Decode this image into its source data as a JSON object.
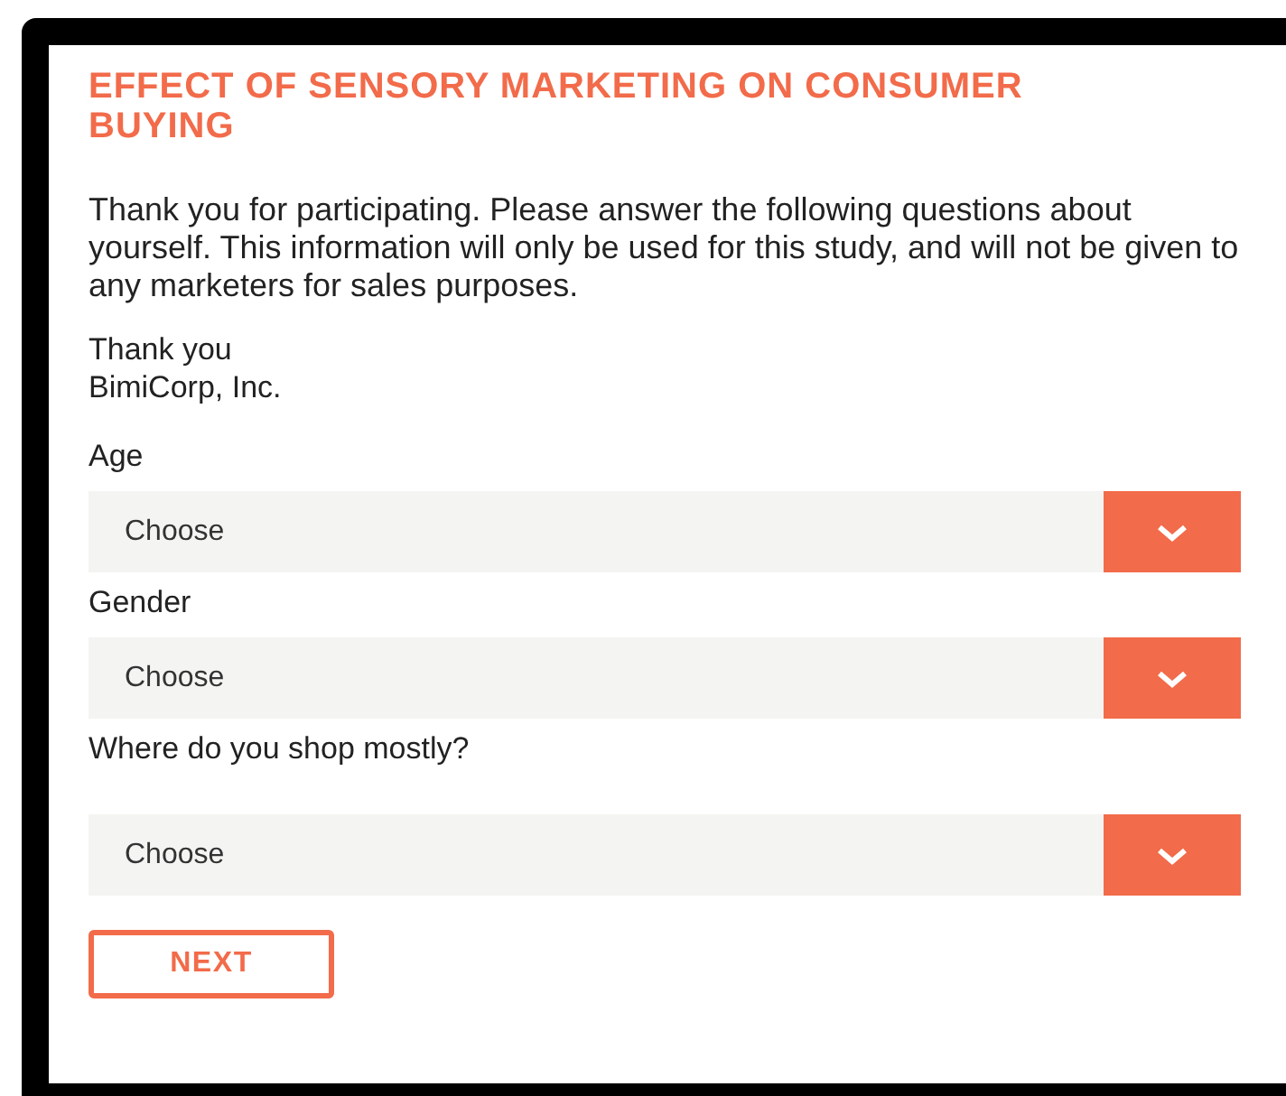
{
  "title": "EFFECT OF SENSORY MARKETING ON CONSUMER BUYING",
  "intro": "Thank you for participating. Please answer the following questions about yourself. This information will only be used for this study, and will not be given to any marketers for sales purposes.",
  "signoff": [
    "Thank you",
    "BimiCorp, Inc."
  ],
  "questions": [
    {
      "label": "Age",
      "value": "Choose"
    },
    {
      "label": "Gender",
      "value": "Choose"
    },
    {
      "label": "Where do you shop mostly?",
      "value": "Choose"
    }
  ],
  "next_button": "NEXT"
}
